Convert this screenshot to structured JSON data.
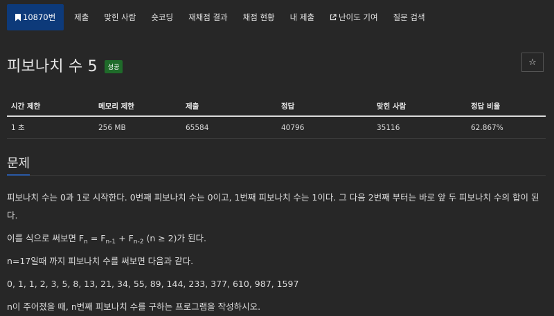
{
  "nav": {
    "active_tab": "10870번",
    "tabs": [
      "제출",
      "맞힌 사람",
      "숏코딩",
      "재채점 결과",
      "채점 현황",
      "내 제출",
      "난이도 기여",
      "질문 검색"
    ]
  },
  "problem": {
    "title": "피보나치 수 5",
    "status_badge": "성공",
    "star": "☆"
  },
  "info_table": {
    "headers": [
      "시간 제한",
      "메모리 제한",
      "제출",
      "정답",
      "맞힌 사람",
      "정답 비율"
    ],
    "row": [
      "1 초",
      "256 MB",
      "65584",
      "40796",
      "35116",
      "62.867%"
    ]
  },
  "section": {
    "title": "문제",
    "p1": "피보나치 수는 0과 1로 시작한다. 0번째 피보나치 수는 0이고, 1번째 피보나치 수는 1이다. 그 다음 2번째 부터는 바로 앞 두 피보나치 수의 합이 된다.",
    "p2_prefix": "이를 식으로 써보면 F",
    "p2_sub1": "n",
    "p2_mid1": " = F",
    "p2_sub2": "n-1",
    "p2_mid2": " + F",
    "p2_sub3": "n-2",
    "p2_suffix": " (n ≥ 2)가 된다.",
    "p3": "n=17일때 까지 피보나치 수를 써보면 다음과 같다.",
    "p4": "0, 1, 1, 2, 3, 5, 8, 13, 21, 34, 55, 89, 144, 233, 377, 610, 987, 1597",
    "p5": "n이 주어졌을 때, n번째 피보나치 수를 구하는 프로그램을 작성하시오."
  }
}
